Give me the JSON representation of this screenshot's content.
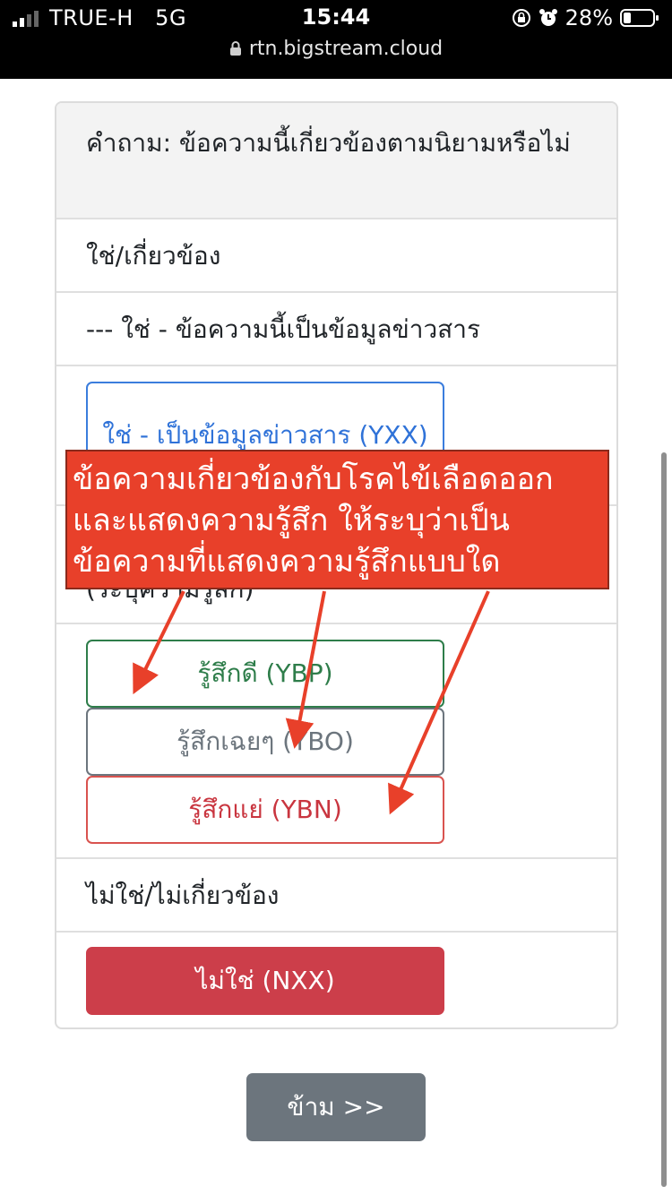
{
  "status_bar": {
    "carrier": "TRUE-H",
    "network": "5G",
    "time": "15:44",
    "battery": "28%",
    "url": "rtn.bigstream.cloud"
  },
  "card": {
    "header": "คำถาม: ข้อความนี้เกี่ยวข้องตามนิยามหรือไม่",
    "section_yes": "ใช่/เกี่ยวข้อง",
    "sub_yes_info": "--- ใช่ - ข้อความนี้เป็นข้อมูลข่าวสาร",
    "btn_yes_info": "ใช่ - เป็นข้อมูลข่าวสาร (YXX)",
    "sub_sentiment": "(ระบุความรู้สึก)",
    "btn_positive": "รู้สึกดี (YBP)",
    "btn_neutral": "รู้สึกเฉยๆ (YBO)",
    "btn_negative": "รู้สึกแย่ (YBN)",
    "section_no": "ไม่ใช่/ไม่เกี่ยวข้อง",
    "btn_no": "ไม่ใช่ (NXX)"
  },
  "skip_label": "ข้าม >>",
  "annotation": {
    "text": "ข้อความเกี่ยวข้องกับโรคไข้เลือดออกและแสดงความรู้สึก ให้ระบุว่าเป็นข้อความที่แสดงความรู้สึกแบบใด",
    "color": "#e8402a"
  },
  "colors": {
    "primary": "#3b7ddd",
    "success": "#2e7d4a",
    "secondary": "#6c757d",
    "danger": "#cc3e4a"
  },
  "icons": [
    "signal-icon",
    "lock-icon",
    "orientation-lock-icon",
    "alarm-icon",
    "battery-icon",
    "arrow-icon"
  ]
}
